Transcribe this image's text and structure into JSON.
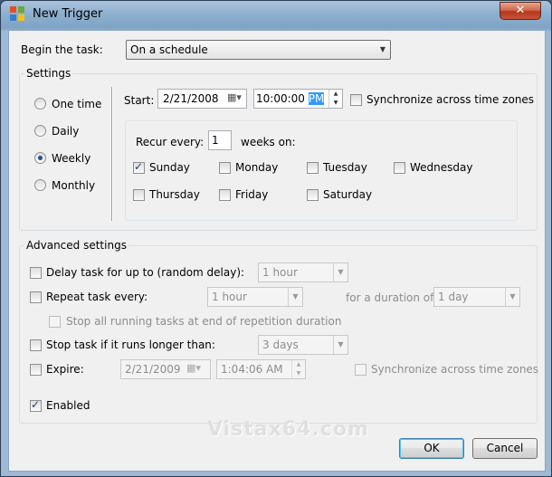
{
  "window": {
    "title": "New Trigger",
    "close_symbol": "✕"
  },
  "begin": {
    "label": "Begin the task:",
    "value": "On a schedule"
  },
  "settings": {
    "title": "Settings",
    "radios": [
      {
        "label": "One time",
        "checked": false
      },
      {
        "label": "Daily",
        "checked": false
      },
      {
        "label": "Weekly",
        "checked": true
      },
      {
        "label": "Monthly",
        "checked": false
      }
    ],
    "start_label": "Start:",
    "start_date": "2/21/2008",
    "start_time_main": "10:00:00",
    "start_time_ampm": "PM",
    "sync_label": "Synchronize across time zones",
    "recur_label": "Recur every:",
    "recur_value": "1",
    "weeks_label": "weeks on:",
    "days": [
      {
        "label": "Sunday",
        "checked": true
      },
      {
        "label": "Monday",
        "checked": false
      },
      {
        "label": "Tuesday",
        "checked": false
      },
      {
        "label": "Wednesday",
        "checked": false
      },
      {
        "label": "Thursday",
        "checked": false
      },
      {
        "label": "Friday",
        "checked": false
      },
      {
        "label": "Saturday",
        "checked": false
      }
    ]
  },
  "advanced": {
    "title": "Advanced settings",
    "delay_label": "Delay task for up to (random delay):",
    "delay_value": "1 hour",
    "repeat_label": "Repeat task every:",
    "repeat_value": "1 hour",
    "duration_label": "for a duration of:",
    "duration_value": "1 day",
    "stop_all_label": "Stop all running tasks at end of repetition duration",
    "stop_longer_label": "Stop task if it runs longer than:",
    "stop_longer_value": "3 days",
    "expire_label": "Expire:",
    "expire_date": "2/21/2009",
    "expire_time": "1:04:06 AM",
    "expire_sync_label": "Synchronize across time zones",
    "enabled_label": "Enabled",
    "enabled_checked": true
  },
  "buttons": {
    "ok": "OK",
    "cancel": "Cancel"
  },
  "watermark": "Vistax64.com"
}
